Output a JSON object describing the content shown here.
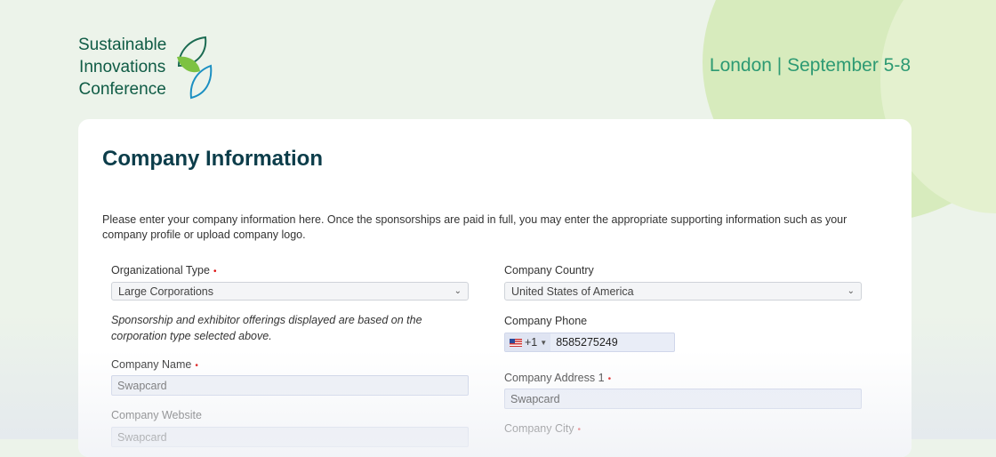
{
  "logo": {
    "lines": [
      "Sustainable",
      "Innovations",
      "Conference"
    ]
  },
  "event": {
    "location_date": "London | September 5-8"
  },
  "form": {
    "title": "Company Information",
    "intro": "Please enter your company information here. Once the sponsorships are paid in full, you may enter the appropriate supporting information such as your company profile or upload company logo.",
    "org_type": {
      "label": "Organizational Type",
      "required": "•",
      "value": "Large Corporations"
    },
    "org_note": "Sponsorship and exhibitor offerings displayed are based on the corporation type selected above.",
    "company_name": {
      "label": "Company Name",
      "required": "•",
      "value": "Swapcard"
    },
    "company_website": {
      "label": "Company Website",
      "value": "Swapcard"
    },
    "company_country": {
      "label": "Company Country",
      "value": "United States of America"
    },
    "company_phone": {
      "label": "Company Phone",
      "country_code": "+1",
      "number": "8585275249"
    },
    "company_address1": {
      "label": "Company Address 1",
      "required": "•",
      "value": "Swapcard"
    },
    "company_city": {
      "label": "Company City",
      "required": "•"
    }
  },
  "colors": {
    "brand": "#0f5b45",
    "accent": "#2d9a73",
    "leaf_green": "#7dc242",
    "leaf_blue": "#1b8fc2"
  }
}
